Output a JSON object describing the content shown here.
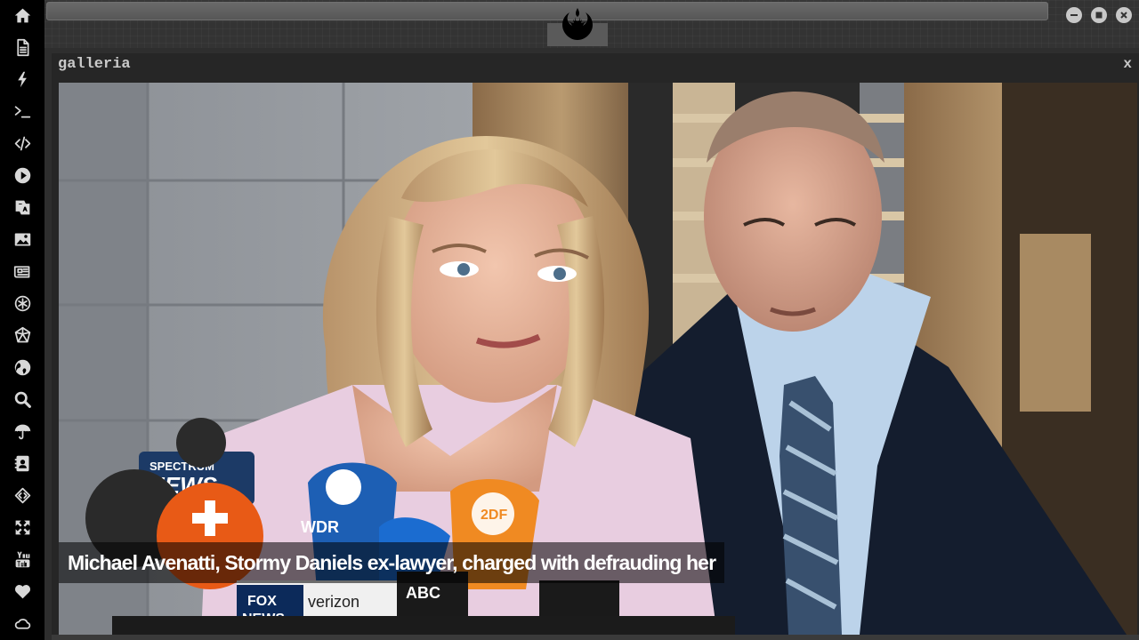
{
  "sidebar": {
    "items": [
      {
        "icon": "home-icon"
      },
      {
        "icon": "document-icon"
      },
      {
        "icon": "lightning-icon"
      },
      {
        "icon": "terminal-icon"
      },
      {
        "icon": "code-icon"
      },
      {
        "icon": "play-icon"
      },
      {
        "icon": "translate-icon"
      },
      {
        "icon": "image-icon"
      },
      {
        "icon": "newspaper-icon"
      },
      {
        "icon": "asterisk-circle-icon"
      },
      {
        "icon": "cube-icon"
      },
      {
        "icon": "globe-icon"
      },
      {
        "icon": "search-icon"
      },
      {
        "icon": "umbrella-icon"
      },
      {
        "icon": "contacts-icon"
      },
      {
        "icon": "code-diamond-icon"
      },
      {
        "icon": "expand-icon"
      },
      {
        "icon": "youtube-icon"
      },
      {
        "icon": "heart-icon"
      },
      {
        "icon": "cloud-icon"
      }
    ]
  },
  "topbar": {
    "logo_icon": "rebel-alliance-logo-icon",
    "window_controls": [
      "minimize-icon",
      "maximize-icon",
      "close-icon"
    ]
  },
  "window": {
    "title": "galleria",
    "close_label": "x"
  },
  "gallery": {
    "caption": "Michael Avenatti, Stormy Daniels ex-lawyer, charged with defrauding her",
    "photo_text": {
      "mic_1": "SPECTRUM",
      "mic_1b": "NEWS",
      "mic_2": "WDR",
      "mic_3": "2DF",
      "mic_4": "verizon",
      "mic_5": "FOX",
      "mic_5b": "NEWS",
      "mic_6": "ABC"
    }
  }
}
